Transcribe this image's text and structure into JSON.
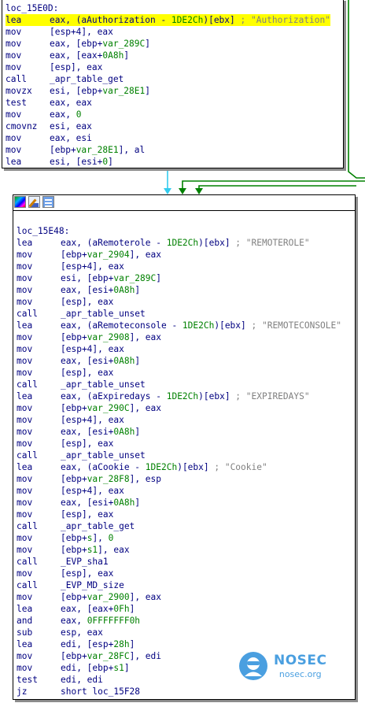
{
  "colors": {
    "flow_blue": "#33ccee",
    "flow_green": "#008000",
    "highlight": "#ffff00",
    "watermark": "#4a9fe0"
  },
  "block1": {
    "label": "loc_15E0D:",
    "instructions": [
      {
        "mn": "lea",
        "ops": "eax, (aAuthorization - 1DE2Ch)[ebx] ; \"Authorization\"",
        "highlight": true
      },
      {
        "mn": "mov",
        "ops": "[esp+4], eax"
      },
      {
        "mn": "mov",
        "ops": "eax, [ebp+var_289C]"
      },
      {
        "mn": "mov",
        "ops": "eax, [eax+0A8h]"
      },
      {
        "mn": "mov",
        "ops": "[esp], eax"
      },
      {
        "mn": "call",
        "ops": "_apr_table_get"
      },
      {
        "mn": "movzx",
        "ops": "esi, [ebp+var_28E1]"
      },
      {
        "mn": "test",
        "ops": "eax, eax"
      },
      {
        "mn": "mov",
        "ops": "eax, 0"
      },
      {
        "mn": "cmovnz",
        "ops": "esi, eax"
      },
      {
        "mn": "mov",
        "ops": "eax, esi"
      },
      {
        "mn": "mov",
        "ops": "[ebp+var_28E1], al"
      },
      {
        "mn": "lea",
        "ops": "esi, [esi+0]"
      }
    ]
  },
  "block2": {
    "toolbar": [
      "graph-colors-icon",
      "rename-icon",
      "view-options-icon"
    ],
    "label": "loc_15E48:",
    "instructions": [
      {
        "mn": "lea",
        "ops": "eax, (aRemoterole - 1DE2Ch)[ebx] ; \"REMOTEROLE\""
      },
      {
        "mn": "mov",
        "ops": "[ebp+var_2904], eax"
      },
      {
        "mn": "mov",
        "ops": "[esp+4], eax"
      },
      {
        "mn": "mov",
        "ops": "esi, [ebp+var_289C]"
      },
      {
        "mn": "mov",
        "ops": "eax, [esi+0A8h]"
      },
      {
        "mn": "mov",
        "ops": "[esp], eax"
      },
      {
        "mn": "call",
        "ops": "_apr_table_unset"
      },
      {
        "mn": "lea",
        "ops": "eax, (aRemoteconsole - 1DE2Ch)[ebx] ; \"REMOTECONSOLE\""
      },
      {
        "mn": "mov",
        "ops": "[ebp+var_2908], eax"
      },
      {
        "mn": "mov",
        "ops": "[esp+4], eax"
      },
      {
        "mn": "mov",
        "ops": "eax, [esi+0A8h]"
      },
      {
        "mn": "mov",
        "ops": "[esp], eax"
      },
      {
        "mn": "call",
        "ops": "_apr_table_unset"
      },
      {
        "mn": "lea",
        "ops": "eax, (aExpiredays - 1DE2Ch)[ebx] ; \"EXPIREDAYS\""
      },
      {
        "mn": "mov",
        "ops": "[ebp+var_290C], eax"
      },
      {
        "mn": "mov",
        "ops": "[esp+4], eax"
      },
      {
        "mn": "mov",
        "ops": "eax, [esi+0A8h]"
      },
      {
        "mn": "mov",
        "ops": "[esp], eax"
      },
      {
        "mn": "call",
        "ops": "_apr_table_unset"
      },
      {
        "mn": "lea",
        "ops": "eax, (aCookie - 1DE2Ch)[ebx] ; \"Cookie\""
      },
      {
        "mn": "mov",
        "ops": "[ebp+var_28F8], esp"
      },
      {
        "mn": "mov",
        "ops": "[esp+4], eax"
      },
      {
        "mn": "mov",
        "ops": "eax, [esi+0A8h]"
      },
      {
        "mn": "mov",
        "ops": "[esp], eax"
      },
      {
        "mn": "call",
        "ops": "_apr_table_get"
      },
      {
        "mn": "mov",
        "ops": "[ebp+s], 0"
      },
      {
        "mn": "mov",
        "ops": "[ebp+s1], eax"
      },
      {
        "mn": "call",
        "ops": "_EVP_sha1"
      },
      {
        "mn": "mov",
        "ops": "[esp], eax"
      },
      {
        "mn": "call",
        "ops": "_EVP_MD_size"
      },
      {
        "mn": "mov",
        "ops": "[ebp+var_2900], eax"
      },
      {
        "mn": "lea",
        "ops": "eax, [eax+0Fh]"
      },
      {
        "mn": "and",
        "ops": "eax, 0FFFFFFF0h"
      },
      {
        "mn": "sub",
        "ops": "esp, eax"
      },
      {
        "mn": "lea",
        "ops": "edi, [esp+28h]"
      },
      {
        "mn": "mov",
        "ops": "[ebp+var_28FC], edi"
      },
      {
        "mn": "mov",
        "ops": "edi, [ebp+s1]"
      },
      {
        "mn": "test",
        "ops": "edi, edi"
      },
      {
        "mn": "jz",
        "ops": "short loc_15F28"
      }
    ]
  },
  "watermark": {
    "title": "NOSEC",
    "subtitle": "nosec.org"
  }
}
